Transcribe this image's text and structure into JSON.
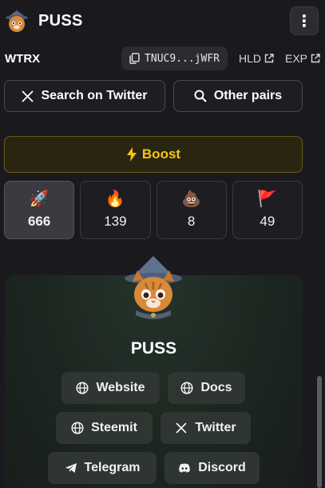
{
  "header": {
    "title": "PUSS",
    "menu_icon": "more-vertical-icon"
  },
  "pair": {
    "quote": "WTRX",
    "address_short": "TNUC9...jWFR",
    "holders_label": "HLD",
    "explorer_label": "EXP"
  },
  "actions": {
    "search_twitter": "Search on Twitter",
    "other_pairs": "Other pairs",
    "boost": "Boost"
  },
  "stats": [
    {
      "emoji": "🚀",
      "count": "666",
      "icon": "rocket-icon"
    },
    {
      "emoji": "🔥",
      "count": "139",
      "icon": "fire-icon"
    },
    {
      "emoji": "💩",
      "count": "8",
      "icon": "poop-icon"
    },
    {
      "emoji": "🚩",
      "count": "49",
      "icon": "red-flag-icon"
    }
  ],
  "card": {
    "name": "PUSS",
    "links": {
      "website": "Website",
      "docs": "Docs",
      "steemit": "Steemit",
      "twitter": "Twitter",
      "telegram": "Telegram",
      "discord": "Discord"
    }
  },
  "colors": {
    "accent_boost": "#f5c518",
    "background": "#1a1a1e"
  }
}
